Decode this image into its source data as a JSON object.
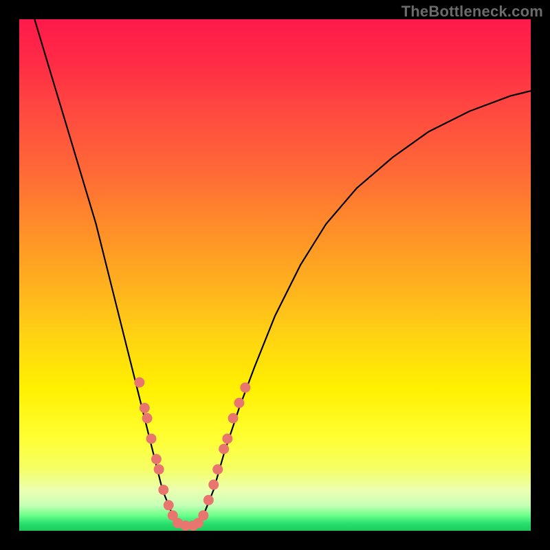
{
  "watermark": "TheBottleneck.com",
  "chart_data": {
    "type": "line",
    "title": "",
    "xlabel": "",
    "ylabel": "",
    "xlim": [
      0,
      100
    ],
    "ylim": [
      0,
      100
    ],
    "grid": false,
    "legend": false,
    "curve_points": [
      {
        "x": 3,
        "y": 100
      },
      {
        "x": 6,
        "y": 90
      },
      {
        "x": 9,
        "y": 80
      },
      {
        "x": 12,
        "y": 70
      },
      {
        "x": 15,
        "y": 60
      },
      {
        "x": 18,
        "y": 48
      },
      {
        "x": 20,
        "y": 40
      },
      {
        "x": 22,
        "y": 32
      },
      {
        "x": 24,
        "y": 24
      },
      {
        "x": 26,
        "y": 16
      },
      {
        "x": 28,
        "y": 8
      },
      {
        "x": 30,
        "y": 3
      },
      {
        "x": 32,
        "y": 1
      },
      {
        "x": 34,
        "y": 1
      },
      {
        "x": 36,
        "y": 3
      },
      {
        "x": 38,
        "y": 8
      },
      {
        "x": 40,
        "y": 15
      },
      {
        "x": 43,
        "y": 24
      },
      {
        "x": 46,
        "y": 32
      },
      {
        "x": 50,
        "y": 42
      },
      {
        "x": 55,
        "y": 52
      },
      {
        "x": 60,
        "y": 60
      },
      {
        "x": 66,
        "y": 67
      },
      {
        "x": 73,
        "y": 73
      },
      {
        "x": 80,
        "y": 78
      },
      {
        "x": 88,
        "y": 82
      },
      {
        "x": 96,
        "y": 85
      },
      {
        "x": 100,
        "y": 86
      }
    ],
    "scatter_points": [
      {
        "x": 23.5,
        "y": 29
      },
      {
        "x": 24.5,
        "y": 24
      },
      {
        "x": 25.0,
        "y": 22
      },
      {
        "x": 25.8,
        "y": 18
      },
      {
        "x": 26.8,
        "y": 14
      },
      {
        "x": 27.3,
        "y": 12
      },
      {
        "x": 28.2,
        "y": 8
      },
      {
        "x": 29.2,
        "y": 5
      },
      {
        "x": 30.0,
        "y": 3
      },
      {
        "x": 31.0,
        "y": 1.5
      },
      {
        "x": 32.5,
        "y": 1
      },
      {
        "x": 34.0,
        "y": 1
      },
      {
        "x": 35.0,
        "y": 1.5
      },
      {
        "x": 36.0,
        "y": 3
      },
      {
        "x": 37.0,
        "y": 6
      },
      {
        "x": 38.0,
        "y": 9
      },
      {
        "x": 38.8,
        "y": 12
      },
      {
        "x": 40.0,
        "y": 16
      },
      {
        "x": 40.7,
        "y": 18
      },
      {
        "x": 41.8,
        "y": 22
      },
      {
        "x": 43.0,
        "y": 25
      },
      {
        "x": 44.2,
        "y": 28
      }
    ],
    "gradient_stops": [
      {
        "pos": 0,
        "color": "#ff1a4b"
      },
      {
        "pos": 40,
        "color": "#ff8b2a"
      },
      {
        "pos": 72,
        "color": "#fff000"
      },
      {
        "pos": 97,
        "color": "#6cff8a"
      },
      {
        "pos": 100,
        "color": "#1acb5e"
      }
    ]
  }
}
